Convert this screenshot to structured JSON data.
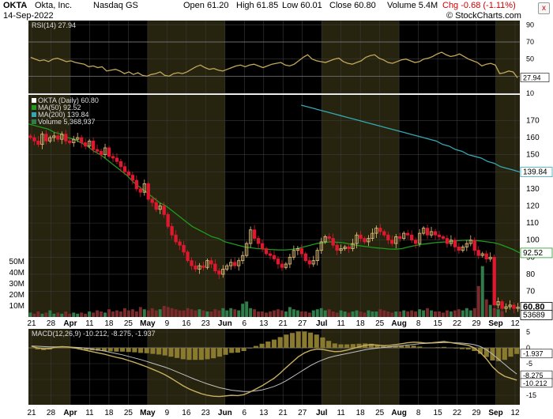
{
  "header": {
    "symbol": "OKTA",
    "company": "Okta, Inc.",
    "exchange": "Nasdaq GS",
    "date": "14-Sep-2022",
    "open": "Open 61.20",
    "high": "High 61.85",
    "low": "Low 60.01",
    "close": "Close 60.80",
    "volume": "Volume 5.4M",
    "change": "Chg -0.68 (-1.11%)",
    "close_button": "x",
    "watermark": "© StockCharts.com",
    "change_color": "#cc0000"
  },
  "colors": {
    "background": "#000000",
    "shade": "#26230f",
    "grid": "#3a3a3a",
    "up": "#e8c37a",
    "down": "#e0182f",
    "rsi": "#c4a85a",
    "ma50": "#1f9a1f",
    "ma200": "#35a8b4",
    "volume": "#2e7d4a",
    "macd": "#c9b060",
    "macd_signal": "#c0c0c0",
    "macd_hist": "#8a7a30"
  },
  "chart_data": [
    {
      "panel": "rsi",
      "type": "line",
      "legend": "RSI(14) 27.94",
      "ylim": [
        10,
        95
      ],
      "y_ticks": [
        "90",
        "70",
        "50",
        "30",
        "10"
      ],
      "last_label": "27.94",
      "reference_lines": [
        70,
        30
      ],
      "values": [
        52,
        50,
        48,
        49,
        47,
        50,
        51,
        49,
        47,
        48,
        46,
        45,
        44,
        41,
        42,
        40,
        41,
        36,
        37,
        38,
        36,
        33,
        35,
        32,
        34,
        31,
        30,
        32,
        33,
        35,
        31,
        30,
        33,
        34,
        33,
        35,
        38,
        41,
        43,
        40,
        38,
        39,
        37,
        36,
        38,
        40,
        42,
        43,
        41,
        43,
        44,
        42,
        40,
        42,
        44,
        45,
        46,
        43,
        42,
        44,
        48,
        52,
        55,
        50,
        48,
        47,
        46,
        48,
        50,
        51,
        47,
        45,
        44,
        46,
        48,
        52,
        54,
        55,
        51,
        49,
        46,
        45,
        47,
        49,
        50,
        48,
        46,
        47,
        50,
        51,
        53,
        56,
        58,
        55,
        53,
        54,
        56,
        53,
        50,
        48,
        46,
        42,
        44,
        45,
        43,
        33,
        34,
        36,
        35,
        28
      ]
    },
    {
      "panel": "price",
      "type": "candlestick",
      "legend": [
        "OKTA (Daily) 60.80",
        "MA(50) 92.52",
        "MA(200) 139.84",
        "Volume 5,368,937"
      ],
      "ylim": [
        55,
        185
      ],
      "y_ticks": [
        "170",
        "160",
        "150",
        "140",
        "130",
        "120",
        "110",
        "100",
        "90",
        "80",
        "70"
      ],
      "last_labels": [
        "139.84",
        "92.52",
        "60.80",
        "53689"
      ],
      "volume_ticks": [
        "50M",
        "40M",
        "30M",
        "20M",
        "10M"
      ],
      "close": [
        160,
        158,
        156,
        162,
        158,
        160,
        161,
        159,
        162,
        158,
        157,
        159,
        160,
        157,
        155,
        158,
        153,
        152,
        150,
        154,
        149,
        148,
        146,
        143,
        140,
        138,
        135,
        130,
        128,
        133,
        124,
        122,
        118,
        120,
        115,
        108,
        103,
        99,
        97,
        93,
        88,
        85,
        83,
        85,
        84,
        88,
        86,
        82,
        80,
        83,
        85,
        87,
        85,
        88,
        91,
        98,
        106,
        101,
        98,
        95,
        92,
        91,
        89,
        86,
        84,
        86,
        90,
        94,
        95,
        92,
        88,
        86,
        88,
        94,
        99,
        102,
        101,
        97,
        94,
        95,
        96,
        95,
        98,
        103,
        101,
        99,
        101,
        104,
        107,
        105,
        103,
        100,
        98,
        102,
        101,
        104,
        103,
        100,
        98,
        104,
        107,
        103,
        105,
        103,
        102,
        101,
        98,
        100,
        96,
        94,
        96,
        98,
        100,
        94,
        91,
        92,
        89,
        90,
        62,
        64,
        60,
        61,
        62,
        60,
        60.8
      ],
      "ma50": [
        168,
        167,
        166,
        165,
        163,
        162,
        160,
        159,
        157,
        155,
        152,
        150,
        147,
        144,
        141,
        138,
        134,
        131,
        128,
        125,
        122,
        120,
        117,
        114,
        111,
        108,
        106,
        104,
        102,
        101,
        99,
        98,
        97,
        96,
        95.5,
        95,
        94.8,
        94.5,
        94.3,
        94.2,
        94.5,
        95,
        96,
        97,
        98,
        98.5,
        99,
        98.8,
        98.5,
        97.8,
        97,
        96.5,
        96,
        95.5,
        95.2,
        94.8,
        94.7,
        95,
        96,
        96.8,
        97.5,
        98,
        98.5,
        98.8,
        99,
        99.5,
        99.8,
        100,
        99.8,
        99.5,
        99,
        98.5,
        97.5,
        96,
        94.5,
        92.52
      ],
      "ma200": [
        179,
        178,
        177,
        176,
        175,
        174,
        173,
        172,
        171,
        170,
        169,
        168,
        167,
        166,
        165,
        164,
        163,
        162,
        161,
        160,
        159,
        158,
        156,
        155,
        153,
        152,
        150,
        149,
        148,
        146,
        145,
        143,
        142,
        141,
        139.84
      ],
      "volume_millions": [
        4,
        3,
        5,
        3,
        4,
        6,
        3,
        4,
        3,
        5,
        3,
        4,
        3,
        4,
        3,
        5,
        4,
        6,
        5,
        4,
        7,
        5,
        6,
        5,
        8,
        6,
        7,
        5,
        9,
        7,
        6,
        8,
        6,
        7,
        10,
        9,
        8,
        7,
        6,
        6,
        8,
        7,
        6,
        7,
        6,
        5,
        5,
        7,
        6,
        8,
        6,
        8,
        7,
        6,
        12,
        14,
        8,
        7,
        5,
        5,
        4,
        5,
        6,
        7,
        6,
        5,
        9,
        7,
        6,
        5,
        5,
        4,
        6,
        7,
        8,
        6,
        7,
        5,
        4,
        6,
        5,
        4,
        5,
        6,
        5,
        4,
        6,
        5,
        5,
        7,
        6,
        5,
        4,
        5,
        5,
        6,
        5,
        6,
        5,
        7,
        6,
        8,
        6,
        5,
        5,
        4,
        6,
        5,
        6,
        7,
        6,
        8,
        6,
        8,
        28,
        46,
        16,
        11,
        8,
        7,
        5.4
      ]
    },
    {
      "panel": "macd",
      "type": "line",
      "legend": "MACD(12,26,9) -10.212, -8.275, -1.937",
      "ylim": [
        -18,
        6
      ],
      "y_ticks": [
        "5",
        "0",
        "-5",
        "-10",
        "-15"
      ],
      "last_labels": [
        "-1.937",
        "-8.275",
        "-10.212"
      ],
      "macd": [
        0.5,
        0,
        -0.3,
        -0.2,
        0.2,
        0.4,
        0.3,
        0,
        -0.4,
        -0.8,
        -1.2,
        -1.6,
        -2,
        -2.5,
        -3,
        -3.4,
        -4,
        -4.6,
        -5.3,
        -6,
        -6.8,
        -7.6,
        -8.5,
        -9.6,
        -10.8,
        -12,
        -13,
        -13.8,
        -14.5,
        -15,
        -15.3,
        -15.4,
        -15.2,
        -15,
        -15.1,
        -14.8,
        -14,
        -13,
        -12,
        -10.8,
        -9.6,
        -8,
        -6.2,
        -4.5,
        -2.8,
        -1.6,
        -0.8,
        -0.4,
        -0.5,
        -0.9,
        -1.2,
        -1.1,
        -0.7,
        -0.2,
        0.3,
        0.8,
        1,
        0.9,
        0.7,
        0.8,
        1,
        1.3,
        1.6,
        1.8,
        1.7,
        1.5,
        1.6,
        1.8,
        2,
        1.7,
        1.4,
        1.1,
        0.8,
        0,
        -1.5,
        -3.5,
        -6,
        -7.8,
        -9,
        -9.6,
        -10.212
      ],
      "signal": [
        0.6,
        0.5,
        0.4,
        0.3,
        0.3,
        0.3,
        0.3,
        0.2,
        0.1,
        -0.1,
        -0.4,
        -0.7,
        -1,
        -1.4,
        -1.8,
        -2.2,
        -2.7,
        -3.2,
        -3.7,
        -4.3,
        -4.9,
        -5.5,
        -6.1,
        -6.8,
        -7.6,
        -8.4,
        -9.2,
        -10,
        -10.7,
        -11.4,
        -12,
        -12.6,
        -13,
        -13.4,
        -13.6,
        -13.8,
        -13.8,
        -13.6,
        -13.3,
        -12.8,
        -12.2,
        -11.4,
        -10.4,
        -9.2,
        -8,
        -6.8,
        -5.6,
        -4.6,
        -3.8,
        -3.1,
        -2.6,
        -2.2,
        -1.8,
        -1.4,
        -1,
        -0.6,
        -0.3,
        -0.1,
        0.1,
        0.3,
        0.5,
        0.7,
        0.9,
        1.1,
        1.3,
        1.4,
        1.5,
        1.6,
        1.7,
        1.7,
        1.6,
        1.5,
        1.3,
        1,
        0.4,
        -0.6,
        -2,
        -3.6,
        -5.2,
        -6.8,
        -8.275
      ]
    }
  ],
  "x_axis": {
    "labels": [
      "21",
      "28",
      "Apr",
      "11",
      "18",
      "25",
      "May",
      "9",
      "16",
      "23",
      "Jun",
      "6",
      "13",
      "21",
      "27",
      "Jul",
      "11",
      "18",
      "25",
      "Aug",
      "8",
      "15",
      "22",
      "29",
      "Sep",
      "12"
    ],
    "bold": [
      "Apr",
      "May",
      "Jun",
      "Jul",
      "Aug",
      "Sep"
    ]
  }
}
